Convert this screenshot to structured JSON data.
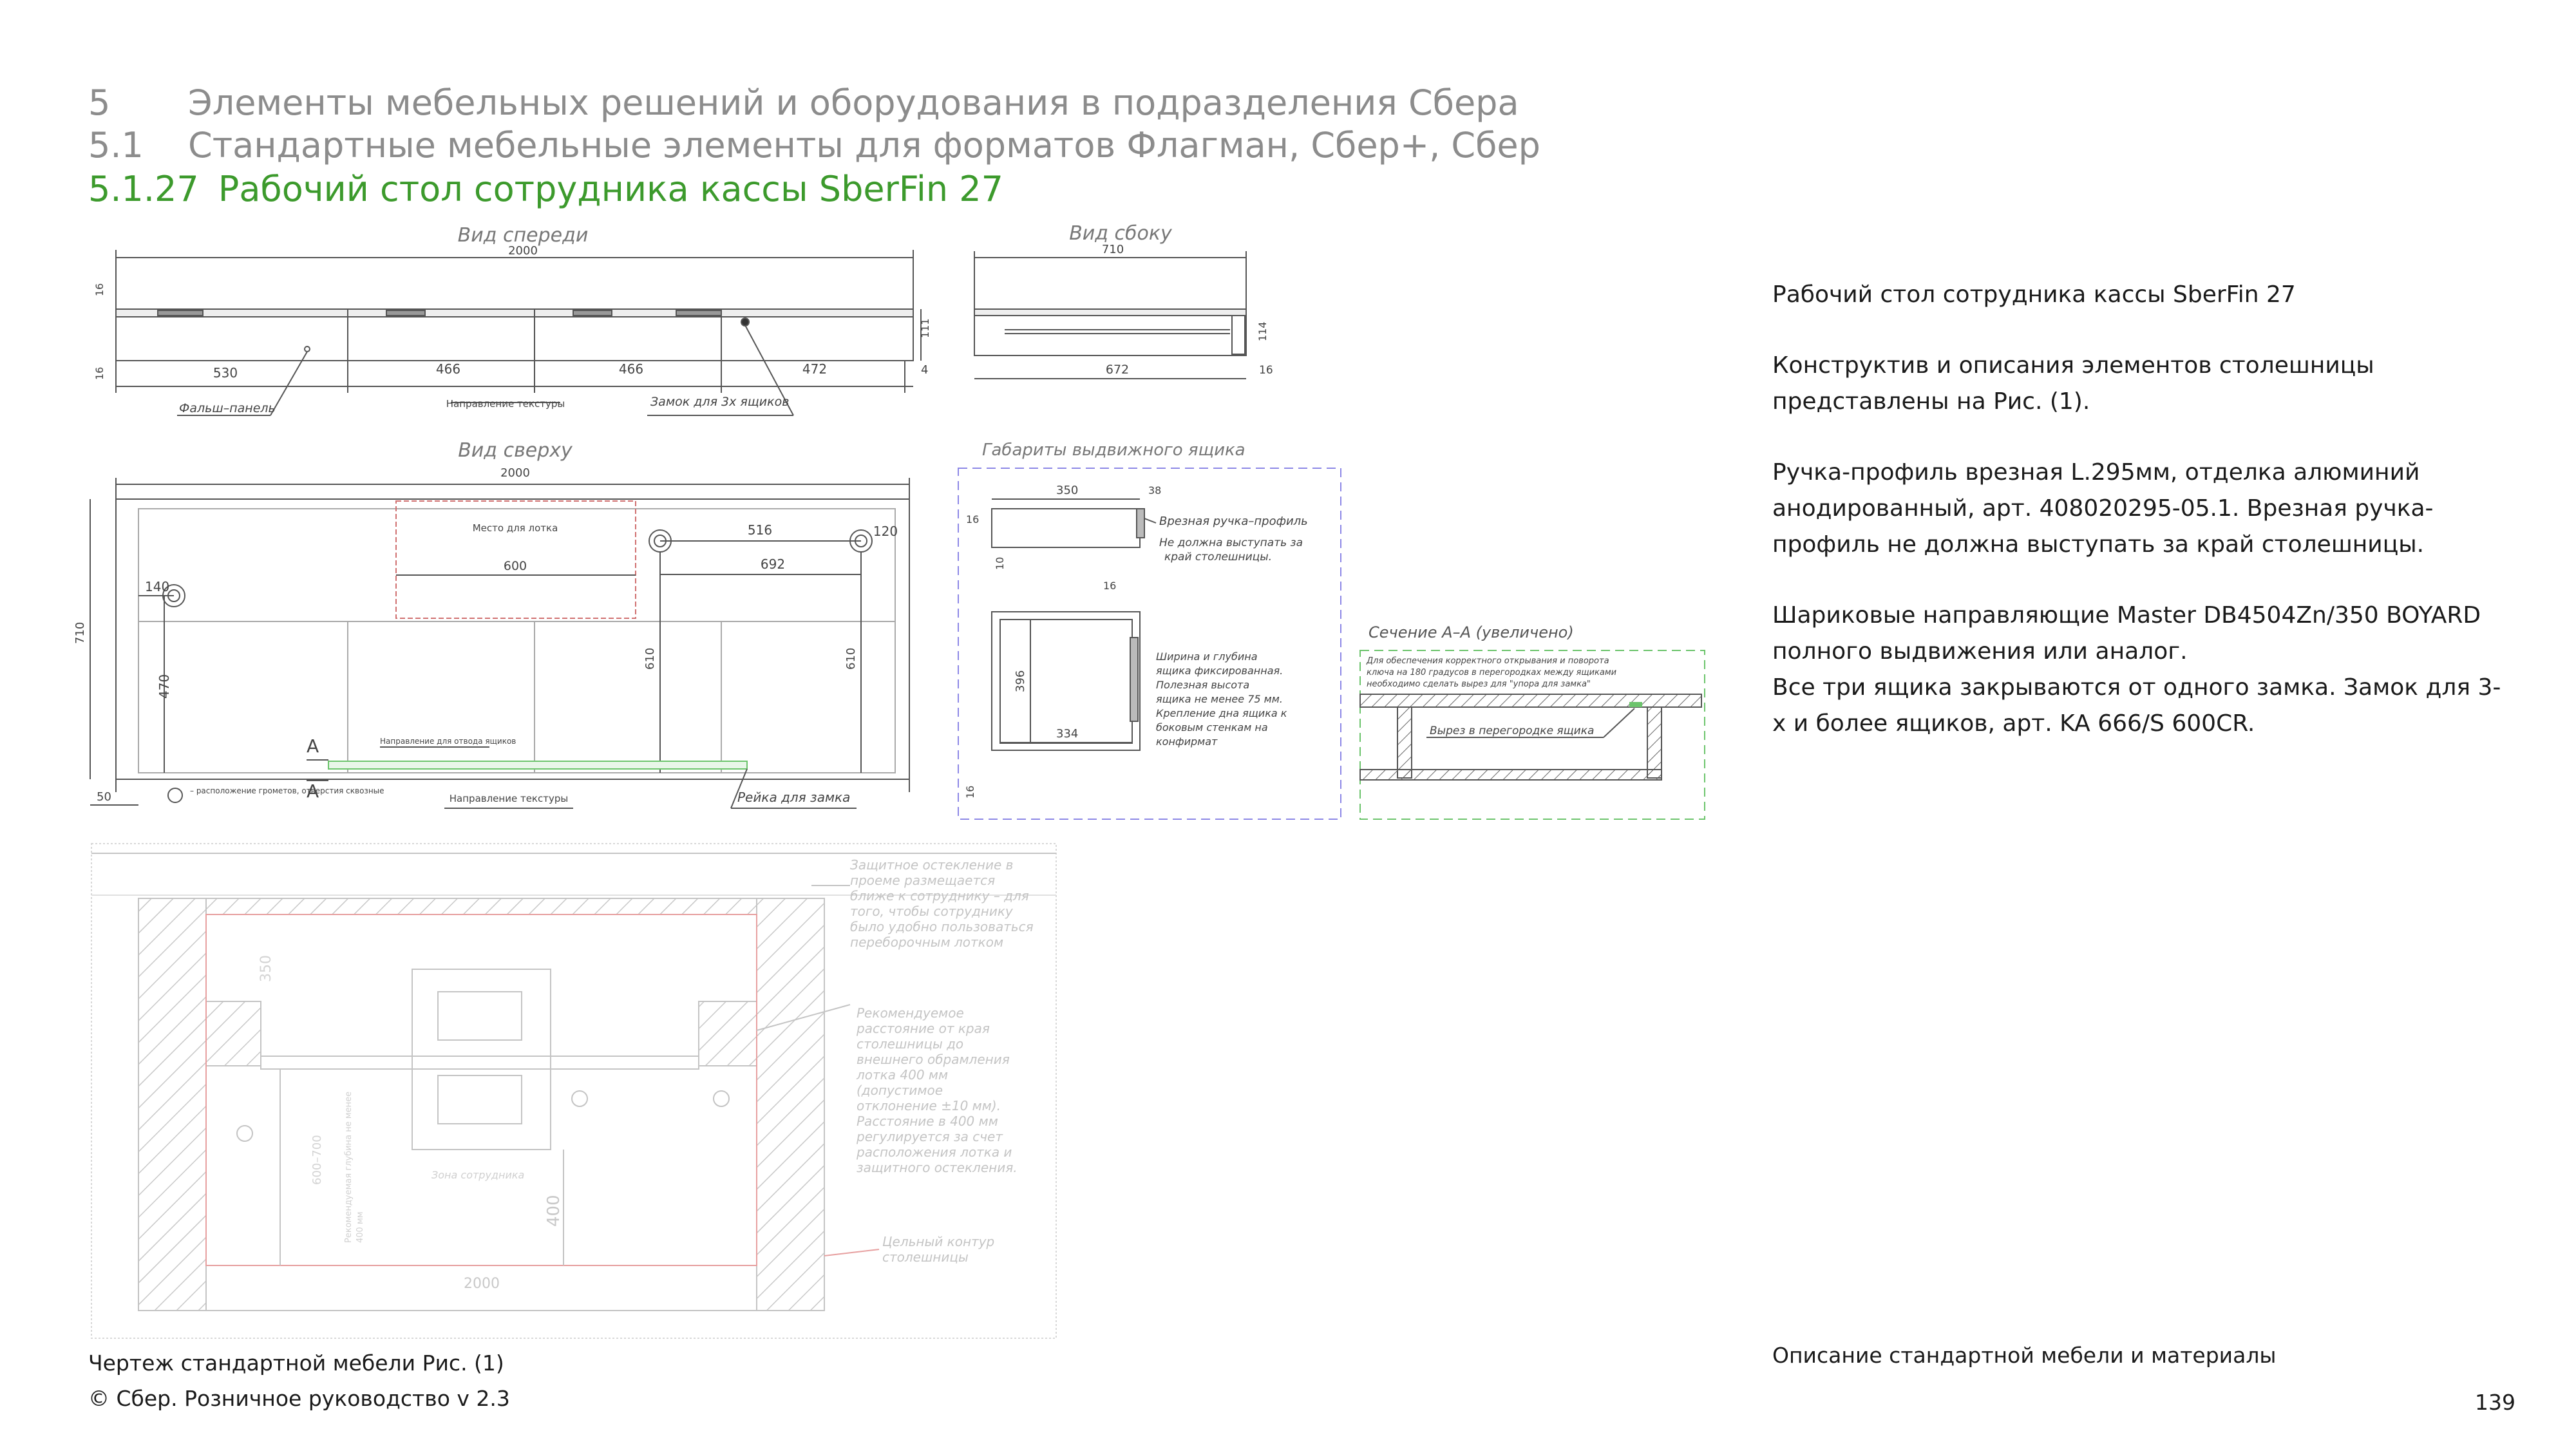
{
  "header": {
    "section_num": "5",
    "section_title": "Элементы мебельных решений и оборудования в подразделения Сбера",
    "subsection_num": "5.1",
    "subsection_title": "Стандартные мебельные элементы для форматов Флагман, Сбер+, Сбер",
    "item_num": "5.1.27",
    "item_title": "Рабочий стол сотрудника кассы SberFin 27"
  },
  "drawing": {
    "front_view_title": "Вид спереди",
    "side_view_title": "Вид сбоку",
    "top_view_title": "Вид сверху",
    "drawer_view_title": "Габариты выдвижного ящика",
    "section_view_title": "Сечение А–А (увеличено)",
    "front": {
      "total": "2000",
      "h16a": "16",
      "h16b": "16",
      "h111": "111",
      "d530": "530",
      "d466a": "466",
      "d466b": "466",
      "d472": "472",
      "d4": "4",
      "label_panel": "Фальш–панель",
      "label_texture": "Направление текстуры",
      "label_lock": "Замок для 3х ящиков"
    },
    "side": {
      "total": "710",
      "d672": "672",
      "d16": "16",
      "h114": "114"
    },
    "top": {
      "total": "2000",
      "depth": "710",
      "place": "Место для лотка",
      "d600": "600",
      "d516": "516",
      "d120": "120",
      "d692": "692",
      "d140": "140",
      "d470": "470",
      "d610a": "610",
      "d610b": "610",
      "d50": "50",
      "section_mark": "А",
      "legend_holes": "– расположение грометов, отверстия сквозные",
      "label_texture": "Направление текстуры",
      "label_rail": "Рейка для замка",
      "rail_note": "Направление для отвода ящиков"
    },
    "drawer": {
      "d350": "350",
      "d38": "38",
      "d16a": "16",
      "d16b": "16",
      "d10": "10",
      "d396": "396",
      "d334": "334",
      "d16c": "16",
      "handle_note": "Врезная ручка–профиль",
      "handle_note2": "Не должна выступать за край столешницы.",
      "size_note": "Ширина и глубина ящика фиксированная. Полезная высота ящика не менее 75 мм. Крепление дна ящика к боковым стенкам на конфирмат"
    },
    "section": {
      "note": "Для обеспечения корректного открывания и поворота ключа на 180 градусов в перегородках между ящиками необходимо сделать вырез для \"упора для замка\"",
      "cut_note": "Вырез в перегородке ящика"
    },
    "plan": {
      "glass_note": "Защитное остекление в проеме размещается ближе к сотруднику – для того, чтобы сотруднику было удобно пользоваться переборочным лотком",
      "distance_note": "Рекомендуемое расстояние от края столешницы до внешнего обрамления лотка 400 мм (допустимое отклонение ±10 мм). Расстояние в 400 мм регулируется за счет расположения лотка и защитного остекления.",
      "contour_note": "Цельный контур столешницы",
      "side_note": "Рекомендуемая глубина не менее 400 мм",
      "d2000": "2000",
      "d400": "400",
      "d350": "350",
      "d500": "600–700",
      "zone": "Зона сотрудника"
    }
  },
  "description": {
    "p1": "Рабочий стол сотрудника кассы SberFin 27",
    "p2": "Конструктив и описания элементов столешницы представлены на Рис. (1).",
    "p3": "Ручка-профиль врезная L.295мм, отделка алюминий анодированный, арт. 408020295-05.1. Врезная ручка-профиль не должна выступать за край столешницы.",
    "p4a": "Шариковые направляющие Master DB4504Zn/350 BOYARD полного выдвижения или аналог.",
    "p4b": "Все три ящика закрываются от одного замка. Замок для 3-х и более ящиков, арт. KA 666/S 600CR."
  },
  "footer": {
    "drawing_caption": "Чертеж стандартной мебели Рис. (1)",
    "copyright": "© Сбер. Розничное руководство  v 2.3",
    "materials_caption": "Описание стандартной мебели и материалы",
    "page_number": "139"
  },
  "colors": {
    "header_gray": "#8c8c8c",
    "accent_green": "#3c9a2c",
    "line": "#555555",
    "blue_dash": "#8c87e6",
    "green_dash": "#6cc46c",
    "red": "#d07070"
  }
}
